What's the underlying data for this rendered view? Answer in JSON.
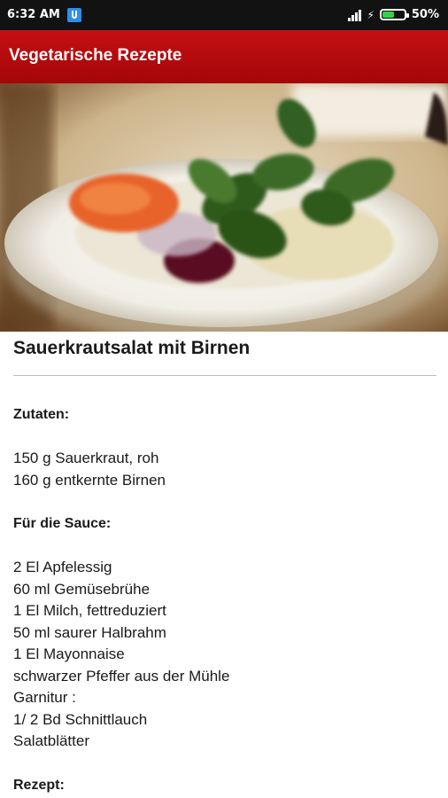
{
  "status_bar": {
    "time": "6:32 AM",
    "battery": "50%"
  },
  "app_bar": {
    "title": "Vegetarische Rezepte"
  },
  "recipe": {
    "title": "Sauerkrautsalat mit Birnen",
    "ingredients_heading": "Zutaten:",
    "ingredients": [
      "150 g Sauerkraut, roh",
      "160 g entkernte Birnen"
    ],
    "sauce_heading": "Für die Sauce:",
    "sauce_items": [
      "2 El Apfelessig",
      "60 ml Gemüsebrühe",
      "1 El Milch, fettreduziert",
      "50 ml saurer Halbrahm",
      "1 El Mayonnaise",
      "schwarzer Pfeffer aus der Mühle",
      "Garnitur :",
      "1/ 2 Bd Schnittlauch",
      "Salatblätter"
    ],
    "method_heading": "Rezept:"
  },
  "colors": {
    "app_bar": "#b20a0d",
    "status_bar": "#121212"
  }
}
